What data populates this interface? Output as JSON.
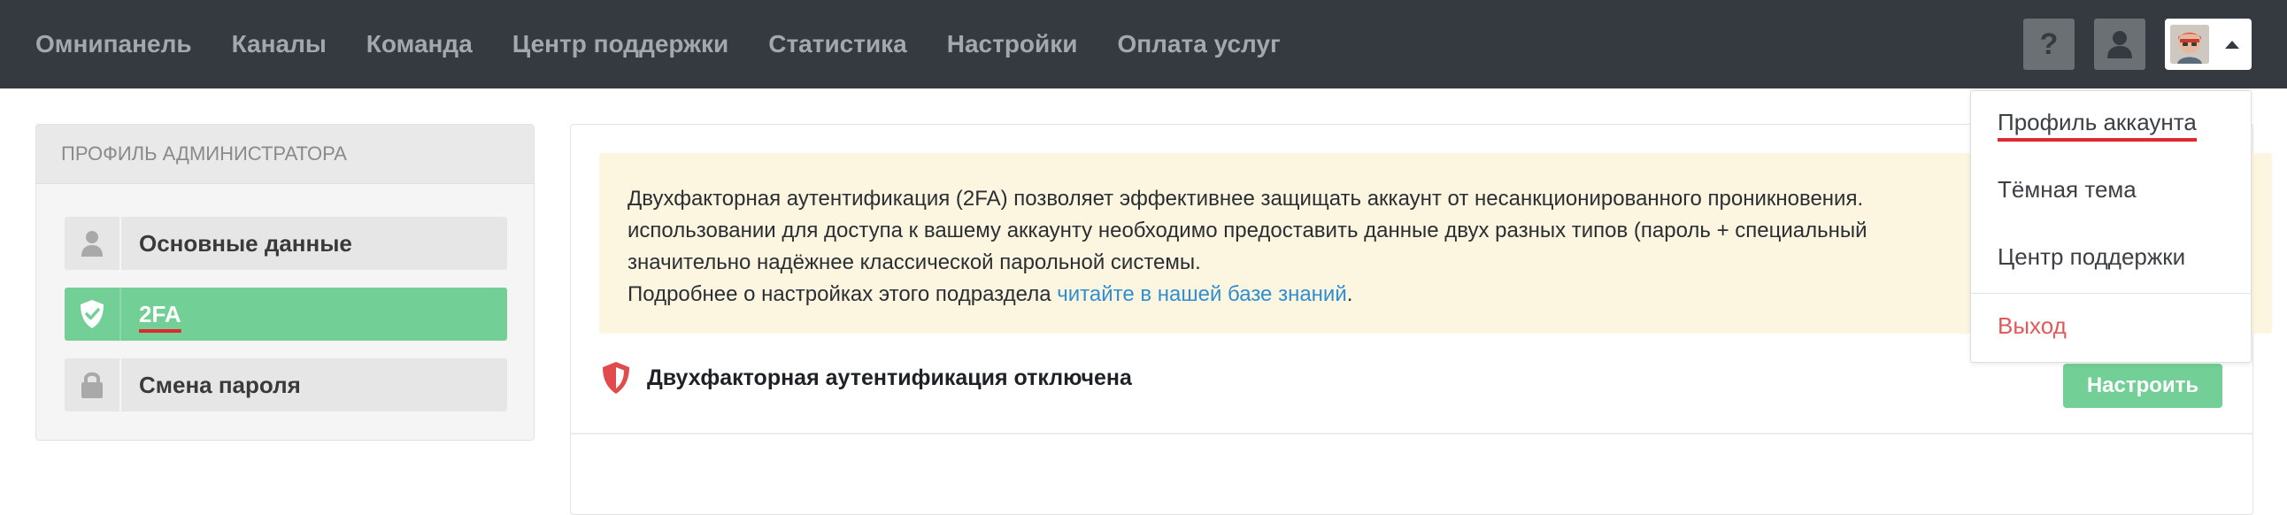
{
  "nav": {
    "items": [
      "Омнипанель",
      "Каналы",
      "Команда",
      "Центр поддержки",
      "Статистика",
      "Настройки",
      "Оплата услуг"
    ],
    "help_label": "?"
  },
  "profile": {
    "header": "ПРОФИЛЬ АДМИНИСТРАТОРА",
    "menu": [
      {
        "label": "Основные данные",
        "icon": "user-icon"
      },
      {
        "label": "2FA",
        "icon": "shield-check-icon"
      },
      {
        "label": "Смена пароля",
        "icon": "lock-icon"
      }
    ]
  },
  "notice": {
    "line1": "Двухфакторная аутентификация (2FA) позволяет эффективнее защищать аккаунт от несанкционированного проникновения.",
    "line2": "использовании для доступа к вашему аккаунту необходимо предоставить данные двух разных типов (пароль + специальный",
    "line3": "значительно надёжнее классической парольной системы.",
    "line4_prefix": "Подробнее о настройках этого подраздела ",
    "line4_link": "читайте в нашей базе знаний",
    "line4_suffix": "."
  },
  "status": {
    "text": "Двухфакторная аутентификация отключена",
    "button": "Настроить"
  },
  "dropdown": {
    "items": [
      "Профиль аккаунта",
      "Тёмная тема",
      "Центр поддержки"
    ],
    "logout": "Выход"
  },
  "colors": {
    "navbar": "#353a40",
    "accent_green": "#72cf95",
    "notice_bg": "#fcf5e0",
    "link": "#2f8fd1",
    "danger": "#e05a5a",
    "underline_red": "#e0282f"
  }
}
